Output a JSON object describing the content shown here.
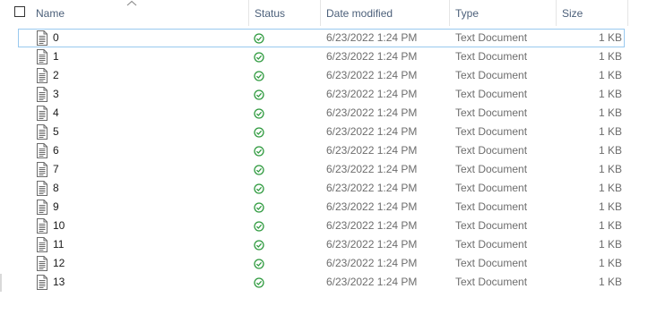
{
  "columns": {
    "name": "Name",
    "status": "Status",
    "date_modified": "Date modified",
    "type": "Type",
    "size": "Size"
  },
  "sort": {
    "column": "name",
    "direction": "ascending",
    "icon": "chevron-up-icon"
  },
  "icons": {
    "file": "text-document-icon",
    "status": "synced-check-icon"
  },
  "colors": {
    "status_green": "#2e9a3e",
    "focus_border": "#99c9ef",
    "header_text": "#4c607a"
  },
  "files": [
    {
      "name": "0",
      "date": "6/23/2022 1:24 PM",
      "type": "Text Document",
      "size": "1 KB"
    },
    {
      "name": "1",
      "date": "6/23/2022 1:24 PM",
      "type": "Text Document",
      "size": "1 KB"
    },
    {
      "name": "2",
      "date": "6/23/2022 1:24 PM",
      "type": "Text Document",
      "size": "1 KB"
    },
    {
      "name": "3",
      "date": "6/23/2022 1:24 PM",
      "type": "Text Document",
      "size": "1 KB"
    },
    {
      "name": "4",
      "date": "6/23/2022 1:24 PM",
      "type": "Text Document",
      "size": "1 KB"
    },
    {
      "name": "5",
      "date": "6/23/2022 1:24 PM",
      "type": "Text Document",
      "size": "1 KB"
    },
    {
      "name": "6",
      "date": "6/23/2022 1:24 PM",
      "type": "Text Document",
      "size": "1 KB"
    },
    {
      "name": "7",
      "date": "6/23/2022 1:24 PM",
      "type": "Text Document",
      "size": "1 KB"
    },
    {
      "name": "8",
      "date": "6/23/2022 1:24 PM",
      "type": "Text Document",
      "size": "1 KB"
    },
    {
      "name": "9",
      "date": "6/23/2022 1:24 PM",
      "type": "Text Document",
      "size": "1 KB"
    },
    {
      "name": "10",
      "date": "6/23/2022 1:24 PM",
      "type": "Text Document",
      "size": "1 KB"
    },
    {
      "name": "11",
      "date": "6/23/2022 1:24 PM",
      "type": "Text Document",
      "size": "1 KB"
    },
    {
      "name": "12",
      "date": "6/23/2022 1:24 PM",
      "type": "Text Document",
      "size": "1 KB"
    },
    {
      "name": "13",
      "date": "6/23/2022 1:24 PM",
      "type": "Text Document",
      "size": "1 KB"
    }
  ]
}
